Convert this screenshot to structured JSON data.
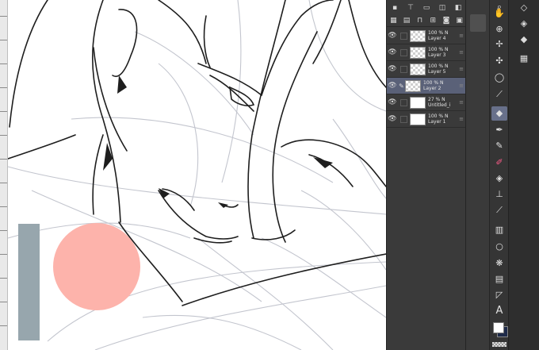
{
  "layers": [
    {
      "opacity": "100 %",
      "mode": "N",
      "name": "Layer 4",
      "thumb": "transparent",
      "visible": true,
      "active": false
    },
    {
      "opacity": "100 %",
      "mode": "N",
      "name": "Layer 3",
      "thumb": "transparent",
      "visible": true,
      "active": false
    },
    {
      "opacity": "100 %",
      "mode": "N",
      "name": "Layer 5",
      "thumb": "transparent",
      "visible": true,
      "active": false
    },
    {
      "opacity": "100 %",
      "mode": "N",
      "name": "Layer 2",
      "thumb": "transparent",
      "visible": true,
      "active": true
    },
    {
      "opacity": "27 %",
      "mode": "N",
      "name": "Untitled_i",
      "thumb": "white",
      "visible": true,
      "active": false
    },
    {
      "opacity": "100 %",
      "mode": "N",
      "name": "Layer 1",
      "thumb": "white",
      "visible": true,
      "active": false
    }
  ],
  "tools": {
    "text_tool_label": "A"
  },
  "colors": {
    "foreground": "#ffffff",
    "background": "#1f2b4a",
    "canvas_circle": "#fdb3ab",
    "canvas_rect": "#97a6ad",
    "active_tool": "#68708a",
    "active_layer": "#5a6178"
  },
  "icons": {
    "layer_toolbar": [
      "new-layer-icon",
      "new-vector-icon",
      "lock-icon",
      "clipping-icon",
      "reference-icon",
      "delete-icon"
    ],
    "tools": [
      "zoom-icon",
      "hand-icon",
      "move-layer-icon",
      "move-icon",
      "lasso-icon",
      "eyedropper-icon",
      "eraser-icon",
      "pen-icon",
      "brush-icon",
      "airbrush-icon",
      "fill-icon",
      "stamp-icon",
      "pencil-icon",
      "gradient-icon",
      "shape-icon",
      "blend-icon",
      "frame-icon",
      "ruler-icon",
      "text-icon"
    ],
    "sub_tools": [
      "eraser-hard-icon",
      "eraser-soft-icon",
      "grid-icon"
    ]
  }
}
